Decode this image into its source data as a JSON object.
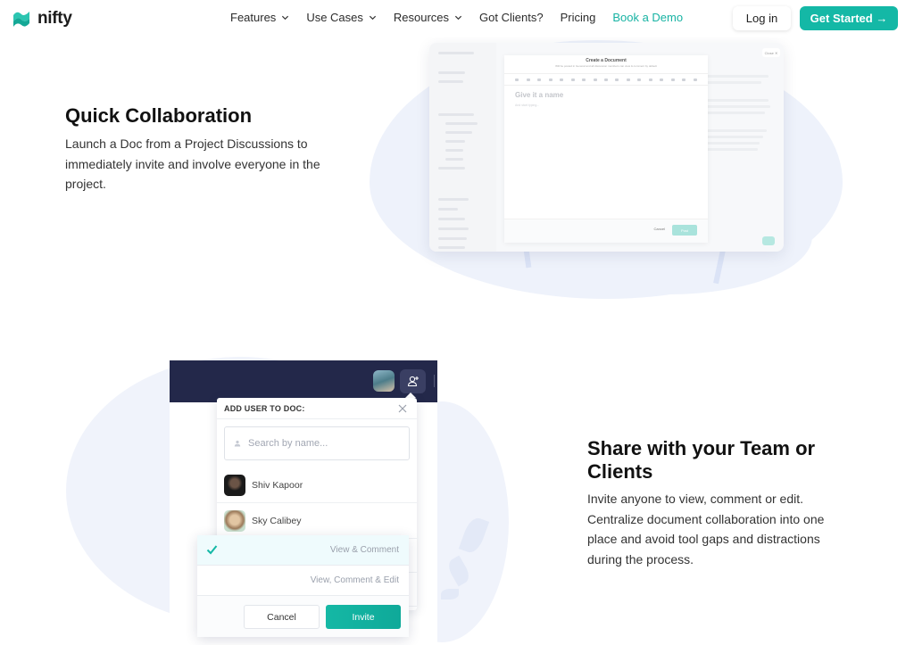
{
  "nav": {
    "logo_text": "nifty",
    "links": [
      {
        "label": "Features",
        "dropdown": true
      },
      {
        "label": "Use Cases",
        "dropdown": true
      },
      {
        "label": "Resources",
        "dropdown": true
      },
      {
        "label": "Got Clients?",
        "dropdown": false
      },
      {
        "label": "Pricing",
        "dropdown": false
      },
      {
        "label": "Book a Demo",
        "dropdown": false
      }
    ],
    "login_label": "Log in",
    "get_started_label": "Get Started →"
  },
  "colors": {
    "brand_teal": "#14b8a6",
    "nav_bar_dark": "#23284a",
    "blob_bg": "#eef2fb"
  },
  "section_quick_collab": {
    "title": "Quick Collaboration",
    "body": "Launch a Doc from a Project Discussions to immediately invite and involve everyone in the project.",
    "mockup": {
      "close_label": "Close ✕",
      "modal_title": "Create a Document",
      "modal_subtitle": "Will be posted in General and all discussion members can view & comment by default",
      "name_placeholder": "Give it a name",
      "body_placeholder": "And start typing...",
      "cancel_label": "Cancel",
      "post_label": "Post"
    }
  },
  "section_share": {
    "title": "Share with your Team or Clients",
    "body": "Invite anyone to view, comment or edit. Centralize document collaboration into one place and avoid tool gaps and distractions during the process.",
    "popover": {
      "title": "ADD USER TO DOC:",
      "search_placeholder": "Search by name...",
      "users": [
        {
          "name": "Shiv Kapoor"
        },
        {
          "name": "Sky Calibey"
        }
      ]
    },
    "permissions": {
      "options": [
        {
          "label": "View & Comment",
          "selected": true
        },
        {
          "label": "View, Comment & Edit",
          "selected": false
        }
      ],
      "cancel_label": "Cancel",
      "invite_label": "Invite"
    }
  }
}
